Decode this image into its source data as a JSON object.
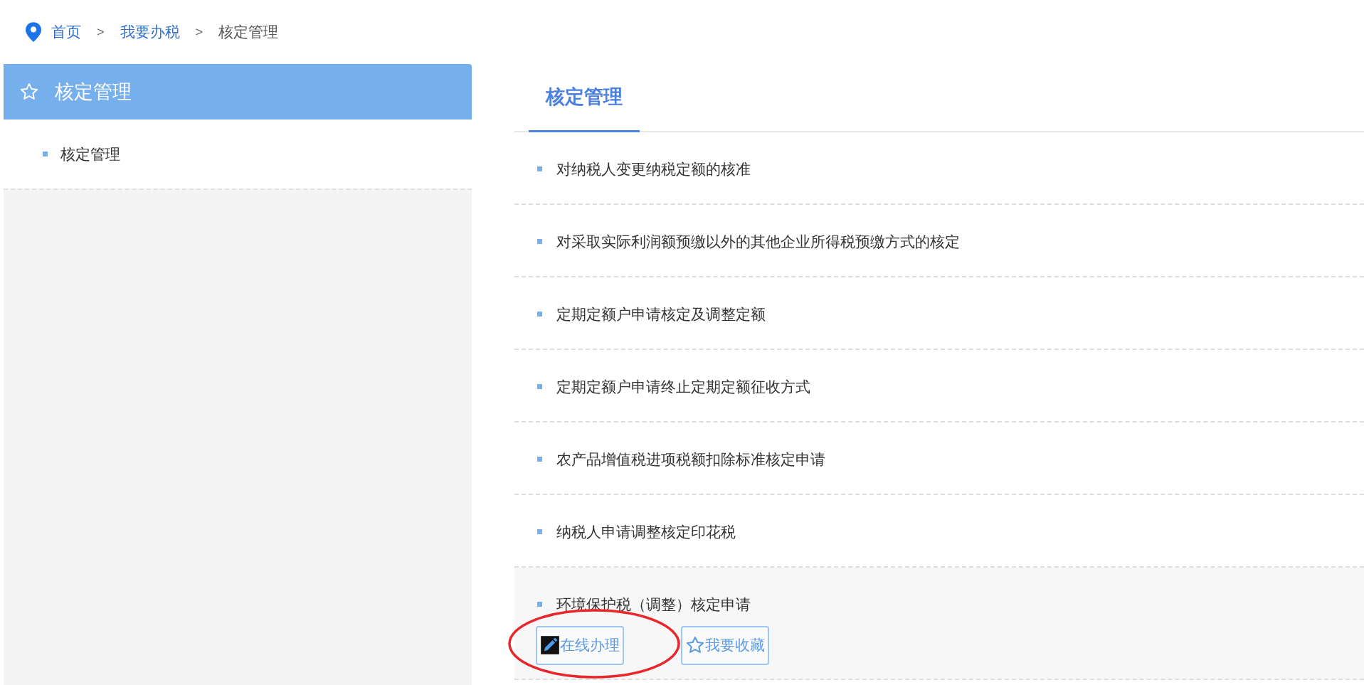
{
  "breadcrumb": [
    {
      "label": "首页",
      "kind": "link"
    },
    {
      "label": "我要办税",
      "kind": "link"
    },
    {
      "label": "核定管理",
      "kind": "current"
    }
  ],
  "breadcrumb_separators": [
    ">",
    ">"
  ],
  "sidebar": {
    "title": "核定管理",
    "items": [
      {
        "label": "核定管理"
      }
    ]
  },
  "tabs": [
    {
      "label": "核定管理",
      "selected": true
    }
  ],
  "items": [
    {
      "label": "对纳税人变更纳税定额的核准",
      "highlighted": false
    },
    {
      "label": "对采取实际利润额预缴以外的其他企业所得税预缴方式的核定",
      "highlighted": false
    },
    {
      "label": "定期定额户申请核定及调整定额",
      "highlighted": false
    },
    {
      "label": "定期定额户申请终止定期定额征收方式",
      "highlighted": false
    },
    {
      "label": "农产品增值税进项税额扣除标准核定申请",
      "highlighted": false
    },
    {
      "label": "纳税人申请调整核定印花税",
      "highlighted": false
    },
    {
      "label": "环境保护税（调整）核定申请",
      "highlighted": true
    }
  ],
  "actions": [
    {
      "label": "在线办理",
      "kind": "online",
      "circled": true
    },
    {
      "label": "我要收藏",
      "kind": "favorite",
      "circled": false
    }
  ]
}
